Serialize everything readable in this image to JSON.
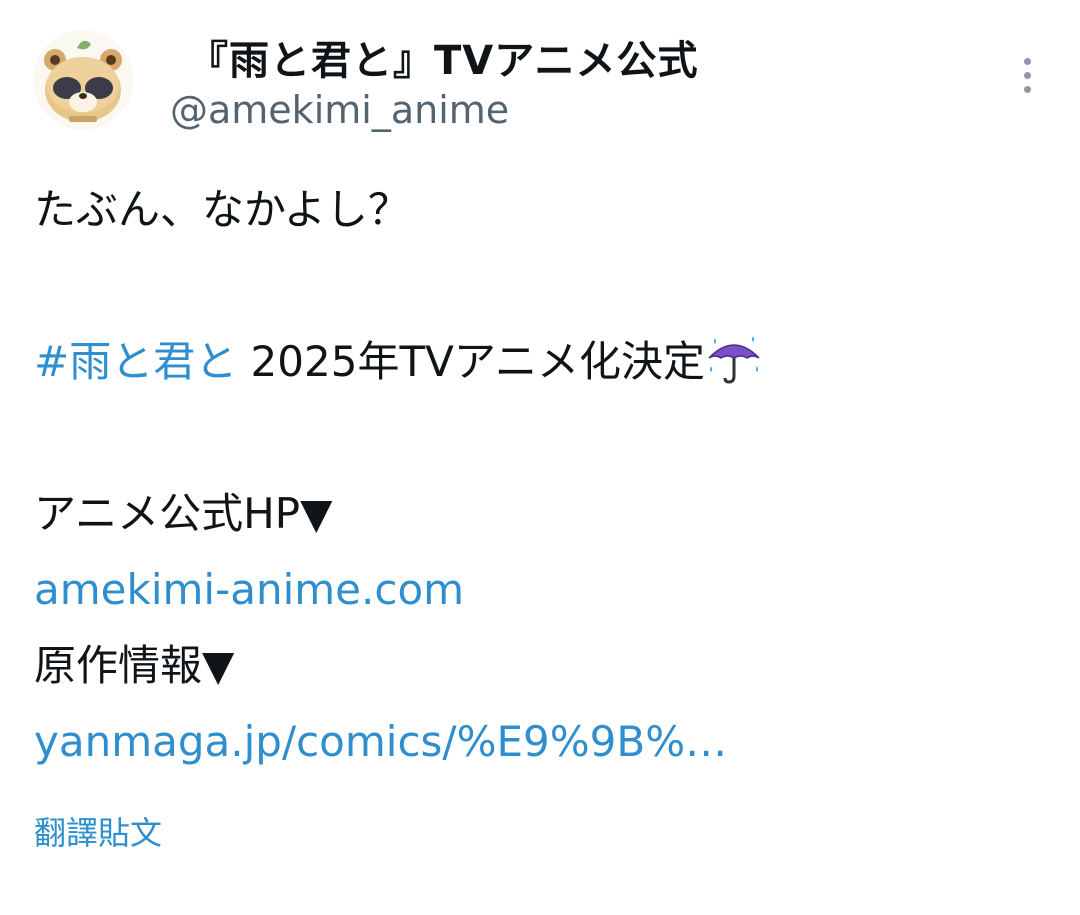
{
  "author": {
    "display_name": "『雨と君と』TVアニメ公式",
    "handle": "@amekimi_anime"
  },
  "tweet": {
    "line1": "たぶん、なかよし？",
    "hashtag": "#雨と君と",
    "line2_text": " 2025年TVアニメ化決定",
    "line3": "アニメ公式HP▼",
    "link1": "amekimi-anime.com",
    "line4": "原作情報▼",
    "link2": "yanmaga.jp/comics/%E9%9B%…"
  },
  "translate_label": "翻譯貼文",
  "icons": {
    "avatar": "tanuki-avatar-icon",
    "more": "more-vertical-icon",
    "emoji": "umbrella-with-rain-icon"
  },
  "colors": {
    "link": "#2f8fce",
    "handle": "#536471",
    "text": "#0f1419"
  }
}
